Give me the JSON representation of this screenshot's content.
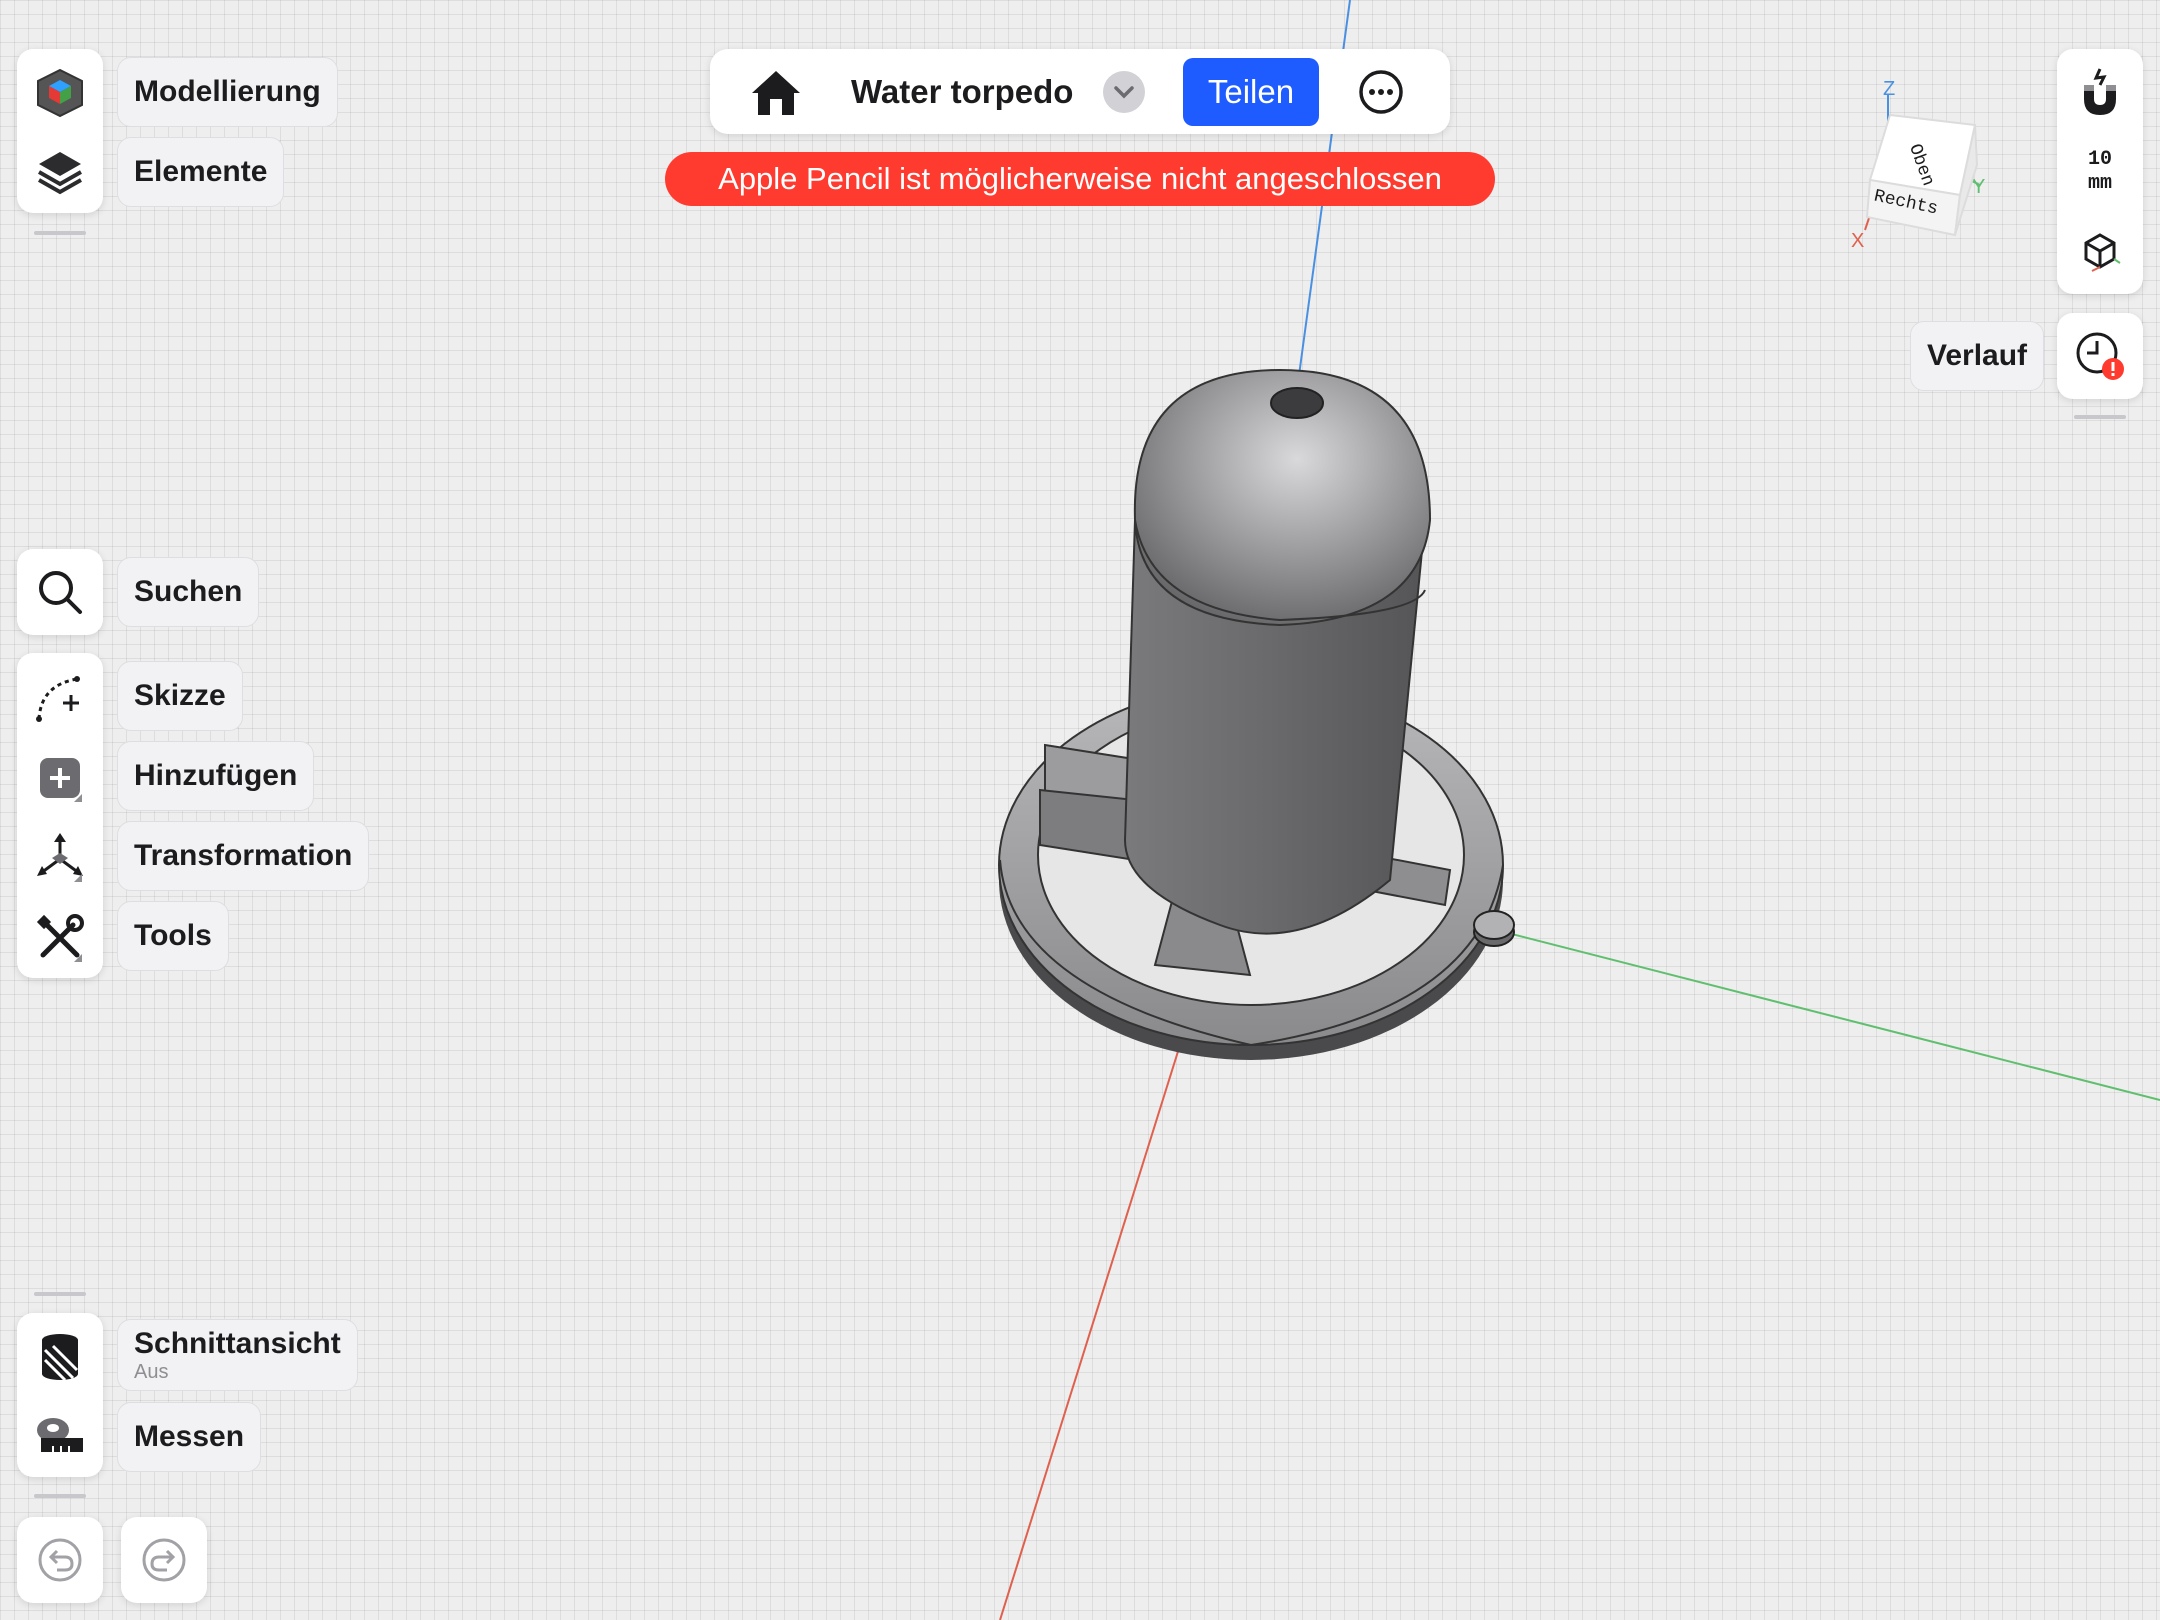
{
  "left_toolbar": {
    "modeling_label": "Modellierung",
    "elements_label": "Elemente",
    "search_label": "Suchen",
    "sketch_label": "Skizze",
    "add_label": "Hinzufügen",
    "transform_label": "Transformation",
    "tools_label": "Tools",
    "section_label": "Schnittansicht",
    "section_status": "Aus",
    "measure_label": "Messen"
  },
  "top_bar": {
    "document_title": "Water torpedo",
    "share_label": "Teilen"
  },
  "toast": {
    "message": "Apple Pencil ist möglicherweise nicht angeschlossen"
  },
  "right_toolbar": {
    "grid_size_value": "10",
    "grid_size_unit": "mm",
    "history_label": "Verlauf"
  },
  "view_cube": {
    "top_face": "Oben",
    "right_face": "Rechts",
    "axis_x": "X",
    "axis_y": "Y",
    "axis_z": "Z"
  },
  "icons": {
    "modeling": "cube-mode-icon",
    "elements": "layers-icon",
    "search": "search-icon",
    "sketch": "sketch-icon",
    "add": "add-icon",
    "transform": "transform-icon",
    "tools": "tools-icon",
    "section": "section-view-icon",
    "measure": "tape-measure-icon",
    "undo": "undo-icon",
    "redo": "redo-icon",
    "home": "home-icon",
    "more": "more-icon",
    "snap": "magnet-icon",
    "view_style": "view-style-cube-icon",
    "history": "history-clock-icon"
  },
  "colors": {
    "accent": "#1f5cff",
    "toast": "#ff3b30",
    "axis_x": "#e0604e",
    "axis_y": "#5fbf6f",
    "axis_z": "#4a90e2",
    "model_gray": "#777777"
  }
}
